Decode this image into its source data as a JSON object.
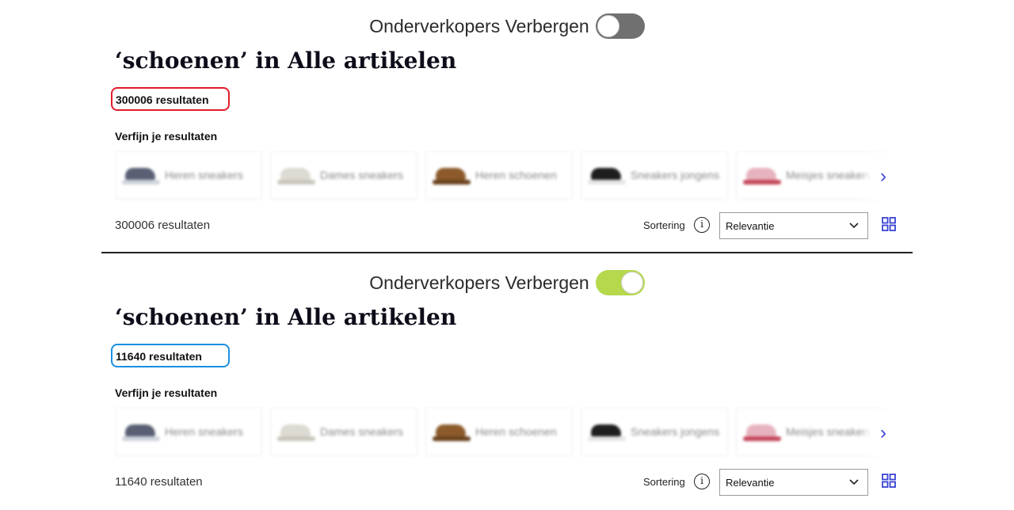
{
  "panels": [
    {
      "toggle_label": "Onderverkopers Verbergen",
      "toggle_state": "off",
      "title": "‘schoenen’ in Alle artikelen",
      "result_count_label": "300006 resultaten",
      "highlight_color": "#e01e2a",
      "refine_title": "Verfijn je resultaten",
      "categories": [
        "Heren sneakers",
        "Dames sneakers",
        "Heren schoenen",
        "Sneakers jongens",
        "Meisjes sneakers"
      ],
      "results_label": "300006 resultaten",
      "sort_label": "Sortering",
      "sort_value": "Relevantie"
    },
    {
      "toggle_label": "Onderverkopers Verbergen",
      "toggle_state": "on",
      "title": "‘schoenen’ in Alle artikelen",
      "result_count_label": "11640 resultaten",
      "highlight_color": "#1a8fe0",
      "refine_title": "Verfijn je resultaten",
      "categories": [
        "Heren sneakers",
        "Dames sneakers",
        "Heren schoenen",
        "Sneakers jongens",
        "Meisjes sneakers"
      ],
      "results_label": "11640 resultaten",
      "sort_label": "Sortering",
      "sort_value": "Relevantie"
    }
  ],
  "colors": {
    "toggle_on": "#b5d84c",
    "toggle_off": "#707070",
    "accent": "#3b44d6"
  },
  "icons": {
    "info": "info-icon",
    "chevron": "chevron-down-icon",
    "grid": "grid-view-icon",
    "next": "chevron-right-icon"
  }
}
